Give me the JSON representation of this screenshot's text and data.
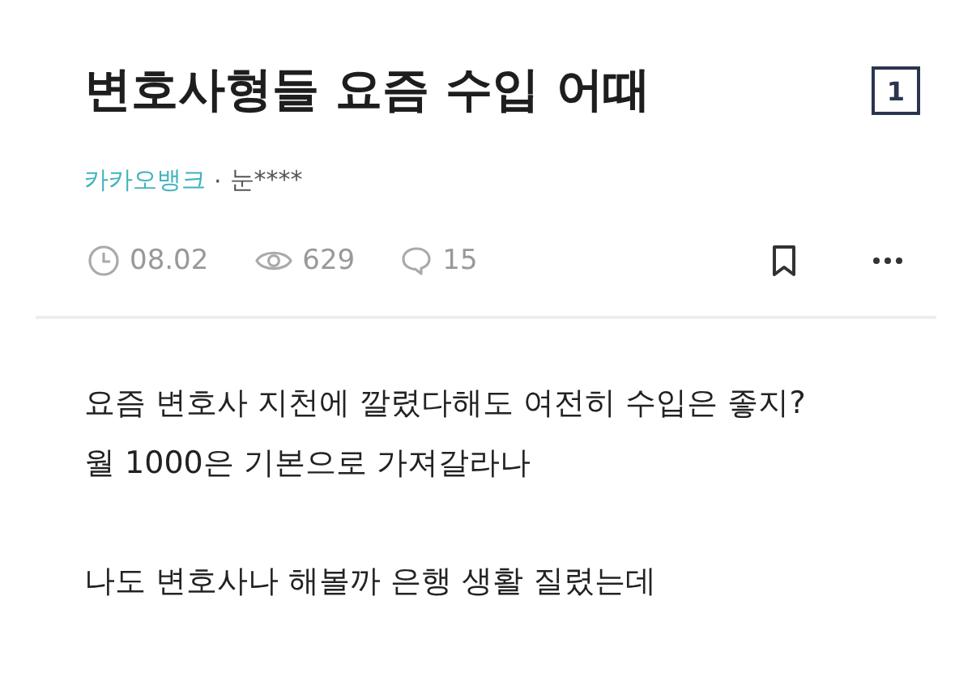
{
  "post": {
    "title": "변호사형들 요즘 수입 어때",
    "page_badge": "1",
    "company": "카카오뱅크",
    "separator": "·",
    "author": "눈****",
    "stats": [
      {
        "kind": "time",
        "text": "08.02"
      },
      {
        "kind": "views",
        "text": "629"
      },
      {
        "kind": "comments",
        "text": "15"
      }
    ],
    "actions": [
      {
        "kind": "bookmark"
      },
      {
        "kind": "more"
      }
    ],
    "paragraphs": [
      [
        "요즘 변호사 지천에 깔렸다해도 여전히 수입은 좋지?",
        "월 1000은 기본으로 가져갈라나"
      ],
      [
        "나도 변호사나 해볼까 은행 생활 질렸는데"
      ]
    ]
  }
}
